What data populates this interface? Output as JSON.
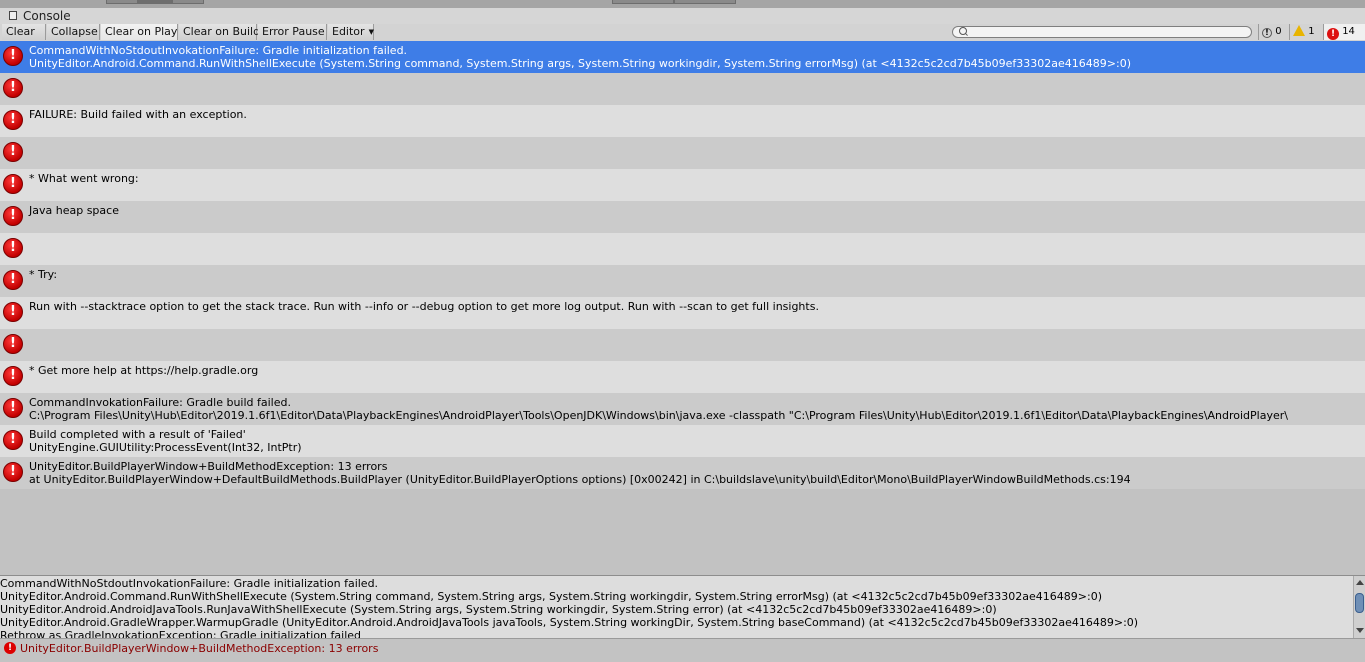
{
  "window": {
    "title": "Console"
  },
  "toolbar": {
    "buttons": [
      {
        "label": "Clear"
      },
      {
        "label": "Collapse"
      },
      {
        "label": "Clear on Play"
      },
      {
        "label": "Clear on Build"
      },
      {
        "label": "Error Pause"
      },
      {
        "label": "Editor"
      }
    ],
    "search": {
      "placeholder": ""
    },
    "counts": {
      "info": "0",
      "warning": "1",
      "error": "14"
    }
  },
  "entries": [
    {
      "line1": "CommandWithNoStdoutInvokationFailure: Gradle initialization failed.",
      "line2": "UnityEditor.Android.Command.RunWithShellExecute (System.String command, System.String args, System.String workingdir, System.String errorMsg) (at <4132c5c2cd7b45b09ef33302ae416489>:0)",
      "selected": true
    },
    {
      "line1": "",
      "line2": ""
    },
    {
      "line1": "FAILURE: Build failed with an exception.",
      "line2": ""
    },
    {
      "line1": "",
      "line2": ""
    },
    {
      "line1": "* What went wrong:",
      "line2": ""
    },
    {
      "line1": "Java heap space",
      "line2": ""
    },
    {
      "line1": "",
      "line2": ""
    },
    {
      "line1": "* Try:",
      "line2": ""
    },
    {
      "line1": "Run with --stacktrace option to get the stack trace. Run with --info or --debug option to get more log output. Run with --scan to get full insights.",
      "line2": ""
    },
    {
      "line1": "",
      "line2": ""
    },
    {
      "line1": "* Get more help at https://help.gradle.org",
      "line2": ""
    },
    {
      "line1": "CommandInvokationFailure: Gradle build failed.",
      "line2": "C:\\Program Files\\Unity\\Hub\\Editor\\2019.1.6f1\\Editor\\Data\\PlaybackEngines\\AndroidPlayer\\Tools\\OpenJDK\\Windows\\bin\\java.exe -classpath \"C:\\Program Files\\Unity\\Hub\\Editor\\2019.1.6f1\\Editor\\Data\\PlaybackEngines\\AndroidPlayer\\"
    },
    {
      "line1": "Build completed with a result of 'Failed'",
      "line2": "UnityEngine.GUIUtility:ProcessEvent(Int32, IntPtr)"
    },
    {
      "line1": "UnityEditor.BuildPlayerWindow+BuildMethodException: 13 errors",
      "line2": "  at UnityEditor.BuildPlayerWindow+DefaultBuildMethods.BuildPlayer (UnityEditor.BuildPlayerOptions options) [0x00242] in C:\\buildslave\\unity\\build\\Editor\\Mono\\BuildPlayerWindowBuildMethods.cs:194"
    }
  ],
  "detail": {
    "lines": [
      "CommandWithNoStdoutInvokationFailure: Gradle initialization failed.",
      "UnityEditor.Android.Command.RunWithShellExecute (System.String command, System.String args, System.String workingdir, System.String errorMsg) (at <4132c5c2cd7b45b09ef33302ae416489>:0)",
      "UnityEditor.Android.AndroidJavaTools.RunJavaWithShellExecute (System.String args, System.String workingdir, System.String error) (at <4132c5c2cd7b45b09ef33302ae416489>:0)",
      "UnityEditor.Android.GradleWrapper.WarmupGradle (UnityEditor.Android.AndroidJavaTools javaTools, System.String workingDir, System.String baseCommand) (at <4132c5c2cd7b45b09ef33302ae416489>:0)",
      "Rethrow as GradleInvokationException: Gradle initialization failed"
    ]
  },
  "status": {
    "text": "UnityEditor.BuildPlayerWindow+BuildMethodException: 13 errors"
  },
  "icons": {
    "error": "error-icon",
    "warning": "warning-icon",
    "info": "info-icon",
    "search": "search-icon"
  },
  "colors": {
    "selection": "#3e7de7",
    "error_red": "#d11111",
    "status_text": "#8a0000"
  }
}
